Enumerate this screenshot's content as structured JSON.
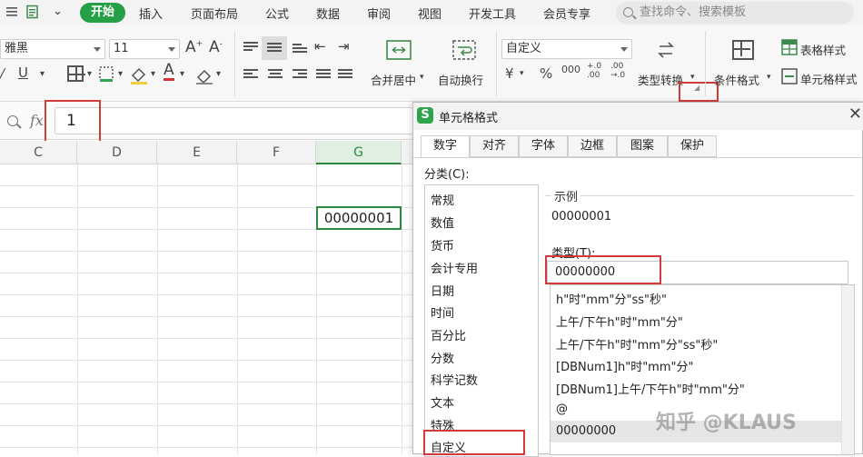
{
  "menubar": {
    "tabs": [
      "开始",
      "插入",
      "页面布局",
      "公式",
      "数据",
      "审阅",
      "视图",
      "开发工具",
      "会员专享"
    ],
    "active_tab": "开始",
    "search_placeholder": "查找命令、搜索模板"
  },
  "ribbon": {
    "font_name": "雅黑",
    "font_size": "11",
    "number_format": "自定义",
    "merge_label": "合并居中",
    "wrap_label": "自动换行",
    "type_convert_label": "类型转换",
    "conditional_format_label": "条件格式",
    "table_style_label": "表格样式",
    "cell_style_label": "单元格样式",
    "font_color": "#d13438",
    "fill_color": "#f4d03f"
  },
  "formula_bar": {
    "fx_label": "fx",
    "value": "1"
  },
  "sheet": {
    "columns": [
      "C",
      "D",
      "E",
      "F",
      "G"
    ],
    "selected_column": "G",
    "selected_cell_value": "00000001",
    "accent_color": "#2b8a3e"
  },
  "dialog": {
    "title": "单元格格式",
    "tabs": [
      "数字",
      "对齐",
      "字体",
      "边框",
      "图案",
      "保护"
    ],
    "active_tab": "数字",
    "category_label": "分类(C):",
    "categories": [
      "常规",
      "数值",
      "货币",
      "会计专用",
      "日期",
      "时间",
      "百分比",
      "分数",
      "科学记数",
      "文本",
      "特殊",
      "自定义"
    ],
    "selected_category": "自定义",
    "sample_label": "示例",
    "sample_value": "00000001",
    "type_label": "类型(T):",
    "type_value": "00000000",
    "formats": [
      "h\"时\"mm\"分\"ss\"秒\"",
      "上午/下午h\"时\"mm\"分\"",
      "上午/下午h\"时\"mm\"分\"ss\"秒\"",
      "[DBNum1]h\"时\"mm\"分\"",
      "[DBNum1]上午/下午h\"时\"mm\"分\"",
      "@",
      "00000000"
    ],
    "selected_format": "00000000",
    "highlight_color": "#d23a3a",
    "brand_color": "#2fa34d"
  },
  "watermark": "知乎 @KLAUS"
}
